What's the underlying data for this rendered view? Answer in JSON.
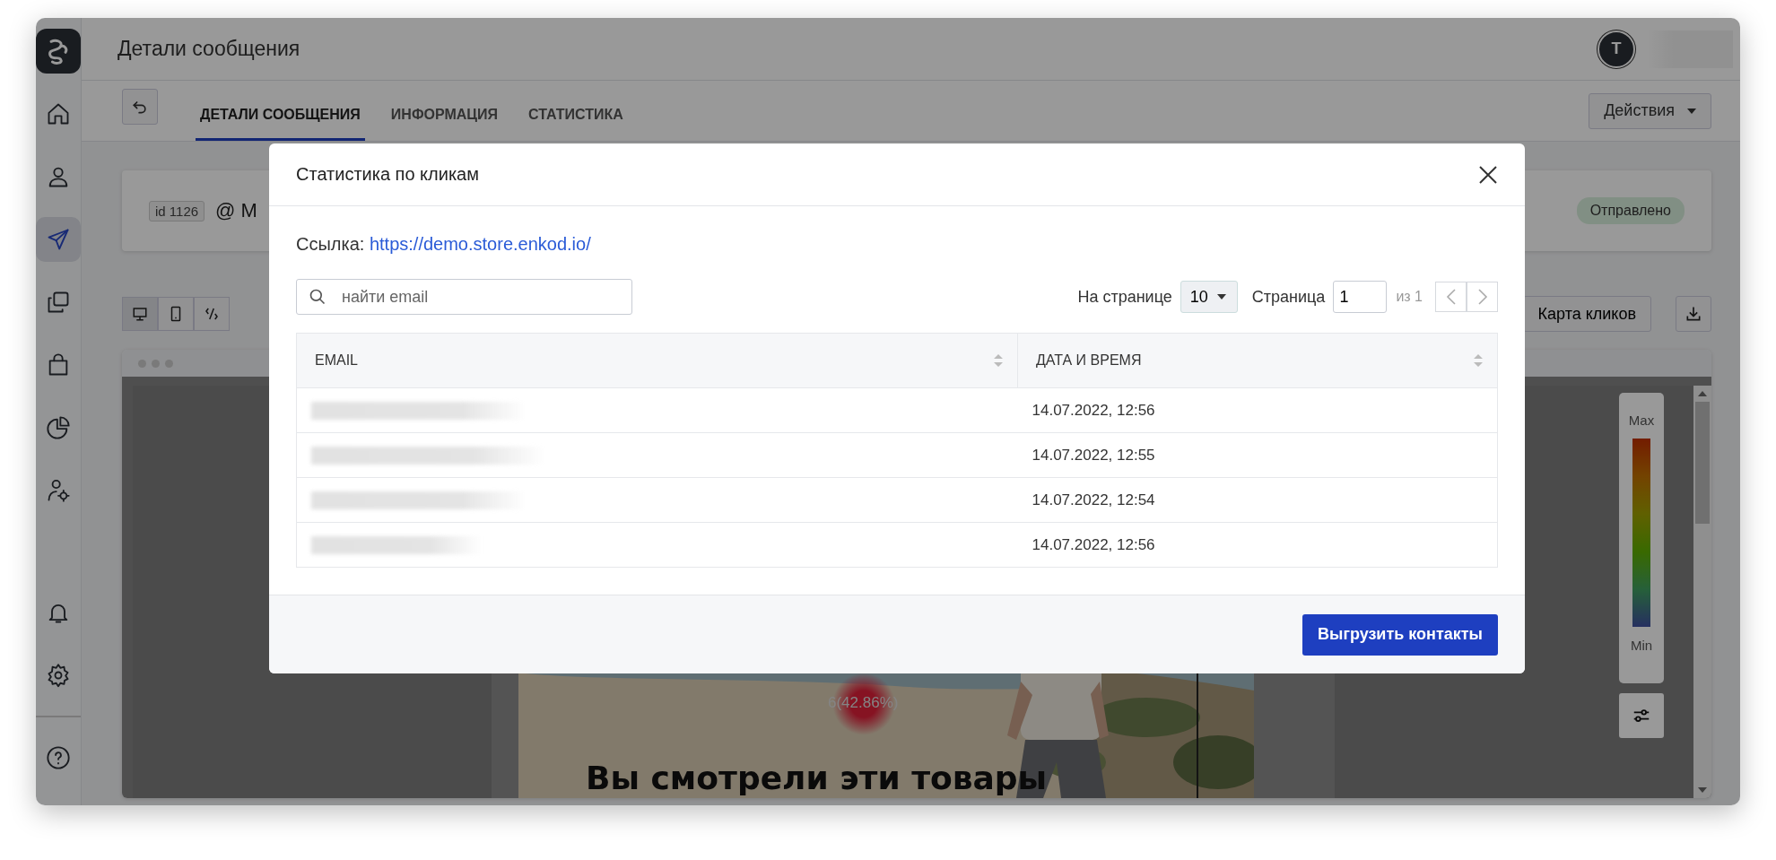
{
  "sidebar": {
    "items": [
      {
        "selected": false
      },
      {
        "selected": false
      },
      {
        "selected": true
      },
      {
        "selected": false
      },
      {
        "selected": false
      },
      {
        "selected": false
      },
      {
        "selected": false
      }
    ],
    "bottom_items": [
      {
        "selected": false
      },
      {
        "selected": false
      },
      {
        "selected": false
      }
    ]
  },
  "header": {
    "title": "Детали сообщения",
    "avatar": "T"
  },
  "tabs": [
    {
      "label": "ДЕТАЛИ СООБЩЕНИЯ",
      "selected": true
    },
    {
      "label": "ИНФОРМАЦИЯ",
      "selected": false
    },
    {
      "label": "СТАТИСТИКА",
      "selected": false
    }
  ],
  "actions_button": "Действия",
  "message_card": {
    "id_badge": "id 1126",
    "subject": "@ M",
    "status": "Отправлено"
  },
  "preview_toolbar": {
    "views": [
      {
        "selected": true
      },
      {
        "selected": false
      },
      {
        "selected": false
      }
    ],
    "click_map_button": "Карта кликов"
  },
  "preview": {
    "heading": "Вы смотрели эти товары",
    "click_label": "6(42.86%)",
    "legend": {
      "max": "Max",
      "min": "Min"
    }
  },
  "modal": {
    "title": "Статистика по кликам",
    "link_label": "Ссылка:",
    "link": "https://demo.store.enkod.io/",
    "search": {
      "placeholder": "найти email"
    },
    "pagination": {
      "per_page_label": "На странице",
      "per_page": "10",
      "page_label": "Страница",
      "page": "1",
      "total": "из 1"
    },
    "table": {
      "columns": [
        "EMAIL",
        "ДАТА И ВРЕМЯ"
      ],
      "rows": [
        {
          "date": "14.07.2022, 12:56"
        },
        {
          "date": "14.07.2022, 12:55"
        },
        {
          "date": "14.07.2022, 12:54"
        },
        {
          "date": "14.07.2022, 12:56"
        }
      ]
    },
    "export_button": "Выгрузить контакты"
  }
}
